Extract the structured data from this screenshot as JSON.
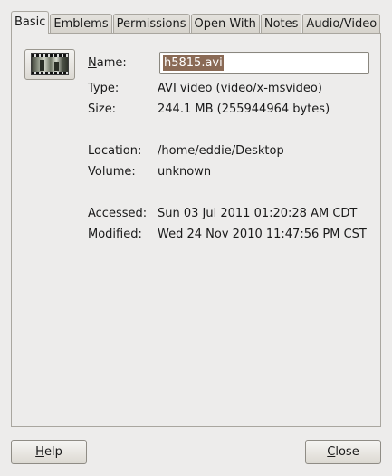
{
  "tabs": [
    "Basic",
    "Emblems",
    "Permissions",
    "Open With",
    "Notes",
    "Audio/Video"
  ],
  "active_tab": "Basic",
  "thumbnail_icon": "video-thumbnail-icon",
  "fields": {
    "name_label": "Name:",
    "name_value": "h5815.avi",
    "type_label": "Type:",
    "type_value": "AVI video (video/x-msvideo)",
    "size_label": "Size:",
    "size_value": "244.1 MB (255944964 bytes)",
    "location_label": "Location:",
    "location_value": "/home/eddie/Desktop",
    "volume_label": "Volume:",
    "volume_value": "unknown",
    "accessed_label": "Accessed:",
    "accessed_value": "Sun 03 Jul 2011 01:20:28 AM CDT",
    "modified_label": "Modified:",
    "modified_value": "Wed 24 Nov 2010 11:47:56 PM CST"
  },
  "buttons": {
    "help": "Help",
    "close": "Close"
  },
  "colors": {
    "window_bg": "#edeceb",
    "selection_bg": "#8a6a55",
    "selection_fg": "#ffffff"
  }
}
